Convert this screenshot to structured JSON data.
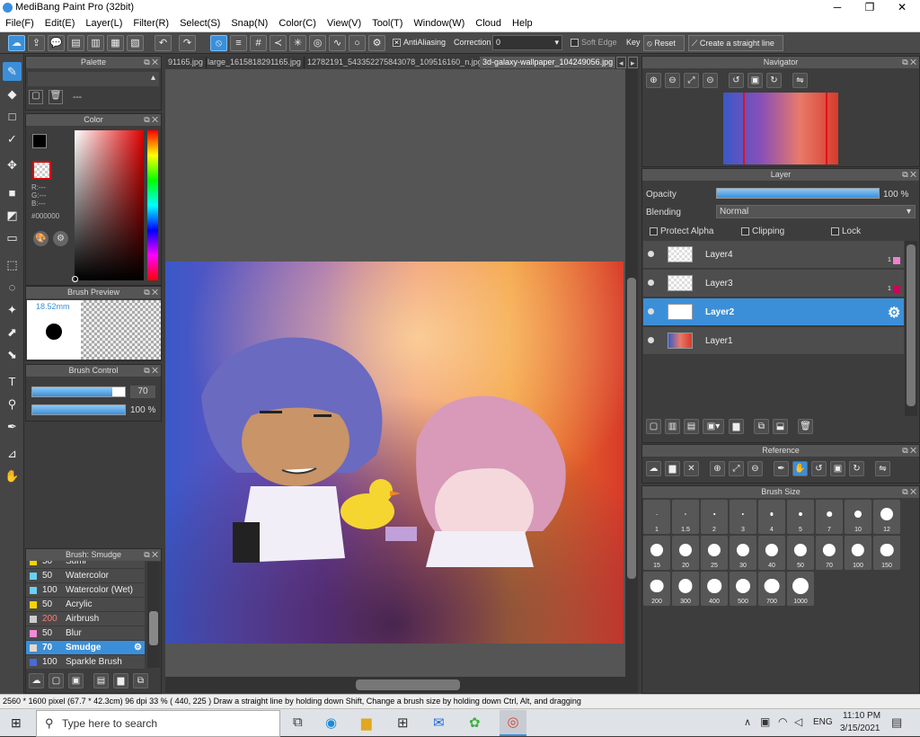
{
  "window": {
    "title": "MediBang Paint Pro (32bit)",
    "minimize": "─",
    "maximize": "❐",
    "close": "✕"
  },
  "menu": [
    "File(F)",
    "Edit(E)",
    "Layer(L)",
    "Filter(R)",
    "Select(S)",
    "Snap(N)",
    "Color(C)",
    "View(V)",
    "Tool(T)",
    "Window(W)",
    "Cloud",
    "Help"
  ],
  "toolbar": {
    "antialiasing": "AntiAliasing",
    "correction_label": "Correction",
    "correction_value": "0",
    "soft_edge": "Soft Edge",
    "key": "Key",
    "reset": "Reset",
    "create_line": "Create a straight line"
  },
  "tabs": [
    "91165.jpg",
    "large_1615818291165.jpg",
    "12782191_543352275843078_109516160_n.jpg",
    "3d-galaxy-wallpaper_104249056.jpg"
  ],
  "palette": {
    "title": "Palette",
    "item": "---"
  },
  "color": {
    "title": "Color",
    "r": "R:---",
    "g": "G:---",
    "b": "B:---",
    "hex": "#000000"
  },
  "brush_preview": {
    "title": "Brush Preview",
    "size": "18.52mm"
  },
  "brush_control": {
    "title": "Brush Control",
    "size_value": "70",
    "opacity_value": "100 %",
    "size_fraction": 0.86,
    "opacity_fraction": 1.0
  },
  "brush_list": {
    "title": "Brush: Smudge",
    "items": [
      {
        "num": "50",
        "name": "Sumi",
        "color": "#f5d400"
      },
      {
        "num": "50",
        "name": "Watercolor",
        "color": "#6ad0f5"
      },
      {
        "num": "100",
        "name": "Watercolor (Wet)",
        "color": "#6ad0f5"
      },
      {
        "num": "50",
        "name": "Acrylic",
        "color": "#f5d400"
      },
      {
        "num": "200",
        "name": "Airbrush",
        "color": "#cccccc",
        "numcolor": "#ff7a7a"
      },
      {
        "num": "50",
        "name": "Blur",
        "color": "#f08ad8"
      },
      {
        "num": "70",
        "name": "Smudge",
        "color": "#e8d8c8"
      },
      {
        "num": "100",
        "name": "Sparkle Brush",
        "color": "#4a6ad8"
      }
    ]
  },
  "navigator": {
    "title": "Navigator"
  },
  "layer": {
    "title": "Layer",
    "opacity_label": "Opacity",
    "opacity_value": "100 %",
    "opacity_fraction": 1.0,
    "blending_label": "Blending",
    "blending_value": "Normal",
    "protect_alpha": "Protect Alpha",
    "clipping": "Clipping",
    "lock": "Lock",
    "layers": [
      {
        "name": "Layer4",
        "badge": "1",
        "badge_color": "#f080d0"
      },
      {
        "name": "Layer3",
        "badge": "1",
        "badge_color": "#d0005a"
      },
      {
        "name": "Layer2",
        "badge": "",
        "badge_color": ""
      },
      {
        "name": "Layer1",
        "badge": "",
        "badge_color": ""
      }
    ]
  },
  "reference": {
    "title": "Reference"
  },
  "brush_size": {
    "title": "Brush Size",
    "sizes": [
      "1",
      "1.5",
      "2",
      "3",
      "4",
      "5",
      "7",
      "10",
      "12",
      "15",
      "20",
      "25",
      "30",
      "40",
      "50",
      "70",
      "100",
      "150",
      "200",
      "300",
      "400",
      "500",
      "700",
      "1000"
    ]
  },
  "status": {
    "text": "2560 * 1600 pixel  (67.7 * 42.3cm)  96 dpi  33 %  ( 440, 225 )  Draw a straight line by holding down Shift, Change a brush size by holding down Ctrl, Alt, and dragging"
  },
  "taskbar": {
    "search_placeholder": "Type here to search",
    "lang": "ENG",
    "time": "11:10 PM",
    "date": "3/15/2021"
  }
}
